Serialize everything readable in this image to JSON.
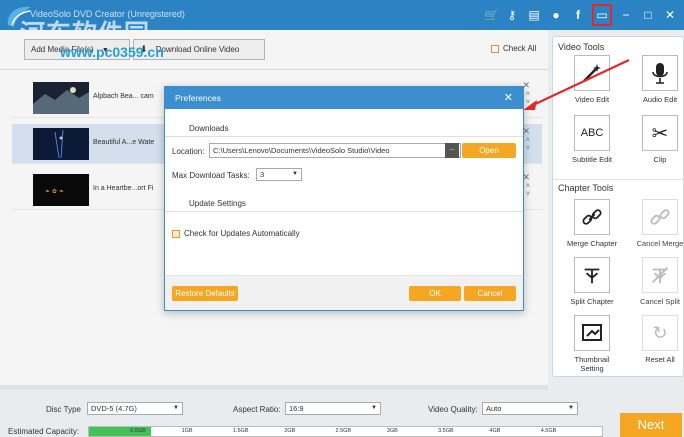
{
  "app": {
    "title": "VideoSolo DVD Creator (Unregistered)",
    "watermark": "河东软件园",
    "watermark_url": "www.pc0359.cn"
  },
  "window_icons": [
    "cart-icon",
    "key-icon",
    "document-icon",
    "help-icon",
    "facebook-icon",
    "feedback-icon",
    "minimize-icon",
    "maximize-icon",
    "close-icon"
  ],
  "toolbar": {
    "add_label": "Add Media File(s)",
    "download_label": "Download Online Video",
    "check_all_label": "Check All"
  },
  "files": [
    {
      "name": "Alpbach Bea... cam",
      "selected": false
    },
    {
      "name": "Beautiful A...e Wate",
      "selected": true
    },
    {
      "name": "In a Heartbe...ort Fi",
      "selected": false
    }
  ],
  "sidebar": {
    "video_tools_title": "Video Tools",
    "video_tools": [
      {
        "label": "Video Edit",
        "icon": "magic-wand-icon"
      },
      {
        "label": "Audio Edit",
        "icon": "microphone-icon"
      },
      {
        "label": "Subtitle Edit",
        "icon": "abc-icon"
      },
      {
        "label": "Clip",
        "icon": "scissors-icon"
      }
    ],
    "chapter_tools_title": "Chapter Tools",
    "chapter_tools": [
      {
        "label": "Merge Chapter",
        "icon": "link-icon"
      },
      {
        "label": "Cancel Merge",
        "icon": "unlink-icon"
      },
      {
        "label": "Split Chapter",
        "icon": "split-icon"
      },
      {
        "label": "Cancel Split",
        "icon": "cancel-split-icon"
      },
      {
        "label": "Thumbnail Setting",
        "icon": "thumbnail-icon"
      },
      {
        "label": "Reset All",
        "icon": "reset-icon"
      }
    ]
  },
  "dialog": {
    "title": "Preferences",
    "downloads_section": "Downloads",
    "location_label": "Location:",
    "location_value": "C:\\Users\\Lenovo\\Documents\\VideoSolo Studio\\Video",
    "browse_label": "...",
    "open_label": "Open",
    "max_tasks_label": "Max Download Tasks:",
    "max_tasks_value": "3",
    "update_section": "Update Settings",
    "check_updates_label": "Check for Updates Automatically",
    "check_updates_checked": true,
    "restore_label": "Restore Defaults",
    "ok_label": "OK",
    "cancel_label": "Cancel"
  },
  "bottom": {
    "disc_type_label": "Disc Type",
    "disc_type_value": "DVD-5 (4.7G)",
    "aspect_label": "Aspect Ratio:",
    "aspect_value": "16:9",
    "quality_label": "Video Quality:",
    "quality_value": "Auto",
    "capacity_label": "Estimated Capacity:",
    "capacity_ticks": [
      "0.5GB",
      "1GB",
      "1.5GB",
      "2GB",
      "2.5GB",
      "3GB",
      "3.5GB",
      "4GB",
      "4.5GB"
    ],
    "capacity_used_gb": 0.6,
    "next_label": "Next"
  },
  "colors": {
    "titlebar": "#2c83c4",
    "accent_orange": "#f5a623",
    "selection": "#dce9f7",
    "capacity_green": "#44c25a",
    "annotation_red": "#e02a2a"
  }
}
